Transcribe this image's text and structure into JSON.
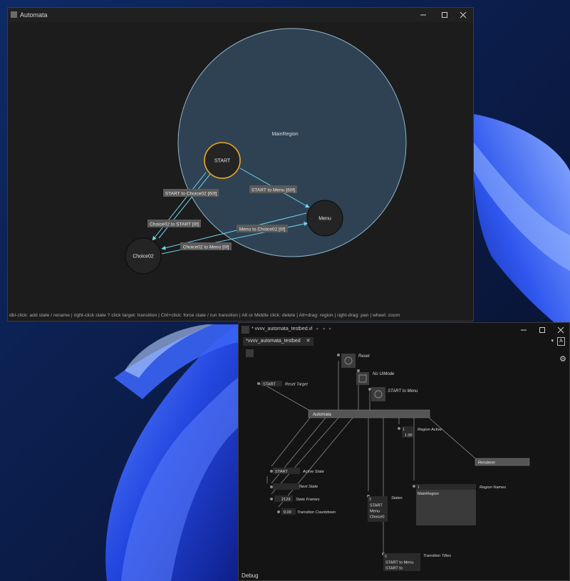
{
  "automata_window": {
    "title": "Automata",
    "region_label": "MainRegion",
    "states": [
      {
        "id": "start",
        "label": "START",
        "active": true
      },
      {
        "id": "menu",
        "label": "Menu",
        "active": false
      },
      {
        "id": "choice02",
        "label": "Choice02",
        "active": false
      }
    ],
    "transitions": [
      {
        "id": "start-to-choice02",
        "label": "START to Choice02 [60f]"
      },
      {
        "id": "start-to-menu",
        "label": "START to Menu [60f]"
      },
      {
        "id": "choice02-to-start",
        "label": "Choice02 to START [0f]"
      },
      {
        "id": "menu-to-choice02",
        "label": "Menu to Choice02 [0f]"
      },
      {
        "id": "choice02-to-menu",
        "label": "Choice02 to Menu [0f]"
      }
    ],
    "status_bar": "dbl-click: add state / rename  |  right-click state ? click target: transition  |  Ctrl+click: force state / run transition  |  Alt or Middle click: delete  |  Alt+drag: region  |  right-drag: pan  |  wheel: zoom"
  },
  "vvvv_window": {
    "title": "* vvvv_automata_testbed.vl",
    "nav_arrows": "◂ ◂ ▸",
    "tab_label": "*vvvv_automata_testbed",
    "tab_close": "✕",
    "tab_dropdown": "▾",
    "tab_badge": "A",
    "settings_icon": "gear-icon",
    "bottom_label": "Debug",
    "nodes": {
      "reset_label": "Reset",
      "no_ui_mode_label": "No UIMode",
      "start_to_menu_label": "START to Menu",
      "reset_target_value": "START",
      "reset_target_label": "Reset Target",
      "automata_node": "Automata",
      "region_active_count": "1",
      "region_active_value": "1.00",
      "region_active_label": "Region Active",
      "renderer_node": "Renderer",
      "active_state_value": "START",
      "active_state_label": "Active State",
      "next_state_value": "",
      "next_state_label": "Next State",
      "state_frames_value": "2129",
      "state_frames_label": "State Frames",
      "transition_countdown_value": "0.00",
      "transition_countdown_label": "Transition Countdown",
      "states_count": "3",
      "states_items": [
        "START",
        "Menu",
        "Choice0"
      ],
      "states_label": "States",
      "region_names_count": "1",
      "region_names_items": [
        "MainRegion"
      ],
      "region_names_label": "Region Names",
      "transition_titles_count": "5",
      "transition_titles_items": [
        "START to Menu",
        "START to"
      ],
      "transition_titles_label": "Transition Titles"
    }
  },
  "colors": {
    "region_fill": "#2e4253",
    "region_stroke": "#8fb6c9",
    "state_fill": "#242424",
    "active_outline": "#f0a820",
    "transition_arrow": "#6fd3ea",
    "label_bg": "#5a5a5a",
    "desktop_accent": "#2a52e8"
  }
}
